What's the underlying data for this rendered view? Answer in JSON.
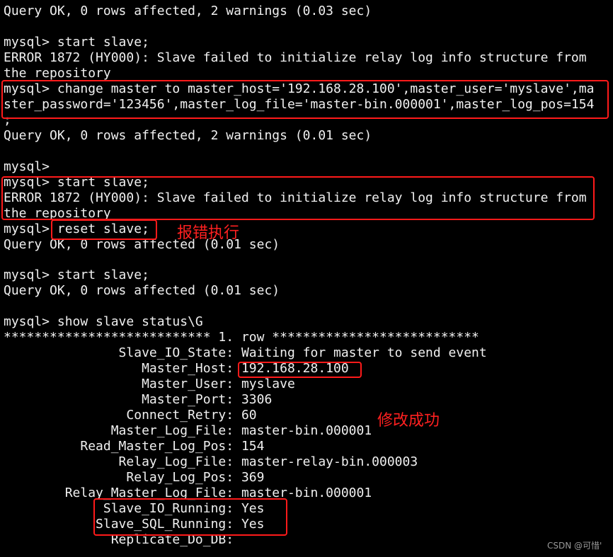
{
  "terminal": {
    "lines": [
      "Query OK, 0 rows affected, 2 warnings (0.03 sec)",
      "",
      "mysql> start slave;",
      "ERROR 1872 (HY000): Slave failed to initialize relay log info structure from",
      "the repository",
      "mysql> change master to master_host='192.168.28.100',master_user='myslave',ma",
      "ster_password='123456',master_log_file='master-bin.000001',master_log_pos=154",
      ";",
      "Query OK, 0 rows affected, 2 warnings (0.01 sec)",
      "",
      "mysql>",
      "mysql> start slave;",
      "ERROR 1872 (HY000): Slave failed to initialize relay log info structure from",
      "the repository",
      "mysql> reset slave;",
      "Query OK, 0 rows affected (0.01 sec)",
      "",
      "mysql> start slave;",
      "Query OK, 0 rows affected (0.01 sec)",
      "",
      "mysql> show slave status\\G",
      "*************************** 1. row ***************************",
      "               Slave_IO_State: Waiting for master to send event",
      "                  Master_Host: 192.168.28.100",
      "                  Master_User: myslave",
      "                  Master_Port: 3306",
      "                Connect_Retry: 60",
      "              Master_Log_File: master-bin.000001",
      "          Read_Master_Log_Pos: 154",
      "               Relay_Log_File: master-relay-bin.000003",
      "                Relay_Log_Pos: 369",
      "        Relay_Master_Log_File: master-bin.000001",
      "             Slave_IO_Running: Yes",
      "            Slave_SQL_Running: Yes",
      "              Replicate_Do_DB:"
    ]
  },
  "annotations": {
    "error_note": "报错执行",
    "success_note": "修改成功",
    "highlight_color": "#ff1a1a"
  },
  "watermark": "CSDN @可惜'"
}
